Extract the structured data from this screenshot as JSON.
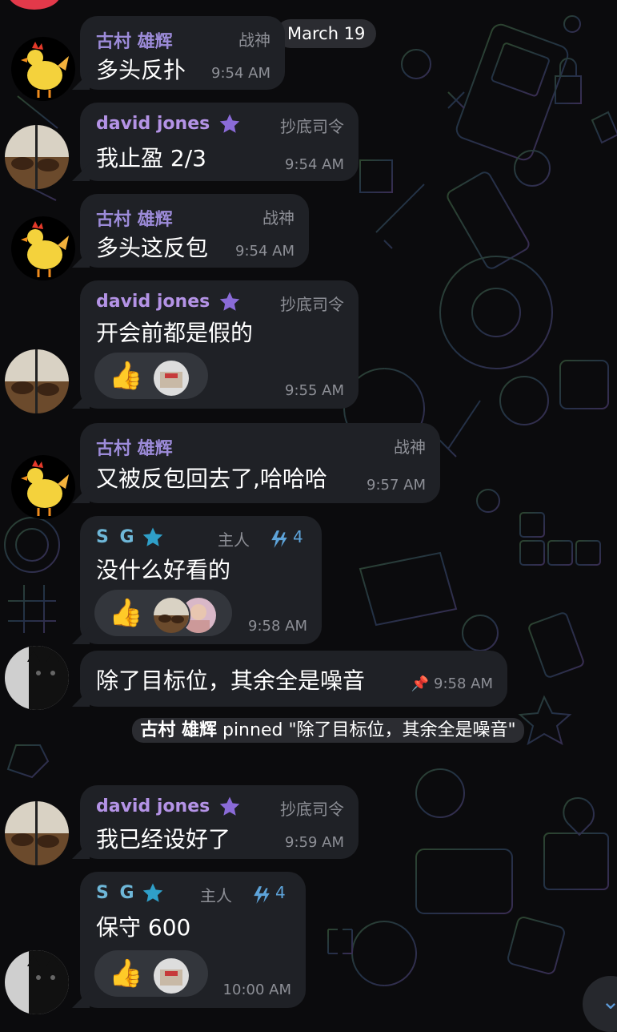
{
  "date_separator": "March 19",
  "messages": [
    {
      "sender": "古村 雄辉",
      "title": "战神",
      "text": "多头反扑",
      "time": "9:54 AM"
    },
    {
      "sender": "david jones",
      "title": "抄底司令",
      "text": "我止盈 2/3",
      "time": "9:54 AM"
    },
    {
      "sender": "古村 雄辉",
      "title": "战神",
      "text": "多头这反包",
      "time": "9:54 AM"
    },
    {
      "sender": "david jones",
      "title": "抄底司令",
      "text": "开会前都是假的",
      "time": "9:55 AM",
      "reaction": "👍"
    },
    {
      "sender": "古村 雄辉",
      "title": "战神",
      "text": "又被反包回去了,哈哈哈",
      "time": "9:57 AM"
    },
    {
      "sender": "S G",
      "title": "主人",
      "boost": "4",
      "text": "没什么好看的",
      "time": "9:58 AM",
      "reaction": "👍"
    },
    {
      "text": "除了目标位，其余全是噪音",
      "time": "9:58 AM"
    },
    {
      "sender": "david jones",
      "title": "抄底司令",
      "text": "我已经设好了",
      "time": "9:59 AM"
    },
    {
      "sender": "S G",
      "title": "主人",
      "boost": "4",
      "text": "保守 600",
      "time": "10:00 AM",
      "reaction": "👍"
    }
  ],
  "service_message": {
    "actor": "古村 雄辉",
    "text": "pinned \"除了目标位，其余全是噪音\""
  },
  "icons": {
    "star": "premium-star-icon",
    "boost": "boost-icon",
    "pin": "pin-icon",
    "scroll": "chevron-down-icon"
  },
  "colors": {
    "bubble": "#1f2126",
    "rooster_name": "#9c8bd9",
    "david_name": "#b493e6",
    "sg_name": "#6eb7d8",
    "meta": "#8d8f96",
    "boost": "#5da3d9"
  }
}
